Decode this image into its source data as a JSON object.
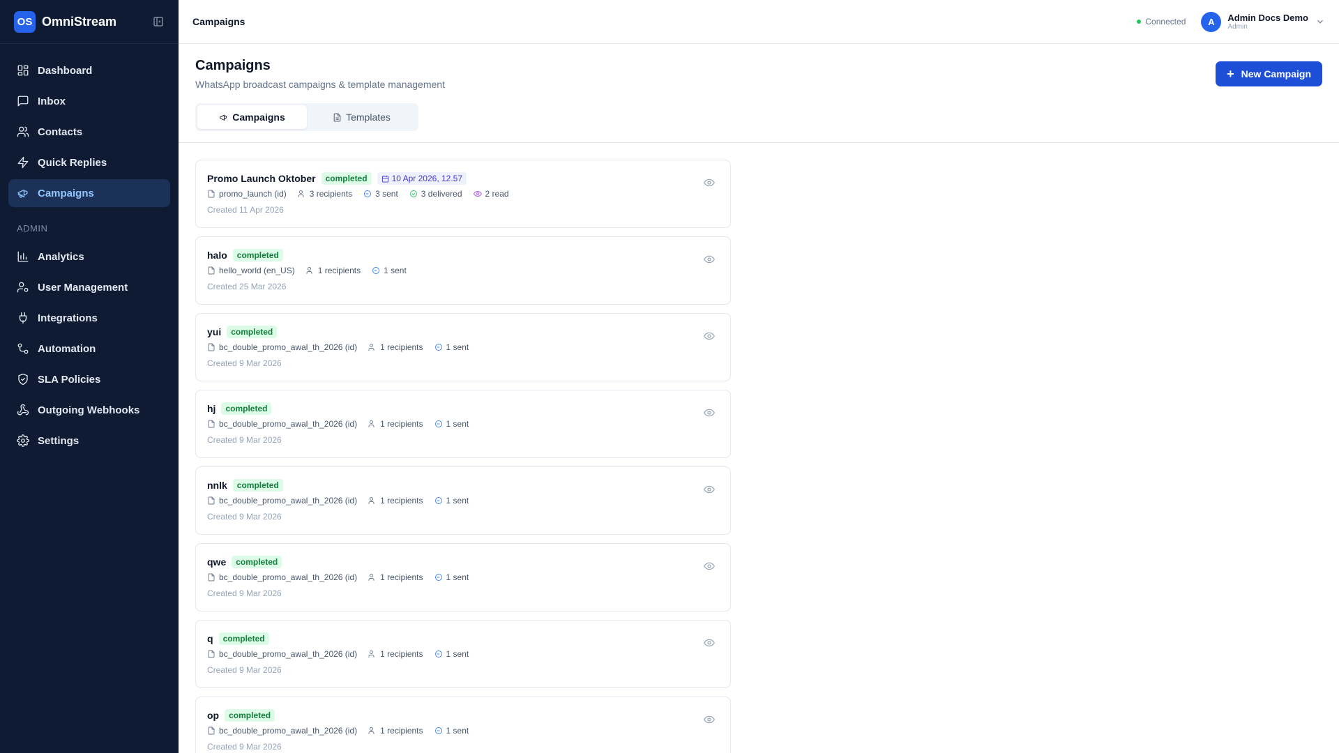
{
  "sidebar": {
    "logo_text": "OS",
    "brand": "OmniStream",
    "items": [
      {
        "label": "Dashboard",
        "icon": "dashboard-icon"
      },
      {
        "label": "Inbox",
        "icon": "inbox-icon"
      },
      {
        "label": "Contacts",
        "icon": "contacts-icon"
      },
      {
        "label": "Quick Replies",
        "icon": "lightning-icon"
      },
      {
        "label": "Campaigns",
        "icon": "megaphone-icon",
        "active": true
      }
    ],
    "admin_section": "ADMIN",
    "admin_items": [
      {
        "label": "Analytics",
        "icon": "chart-icon"
      },
      {
        "label": "User Management",
        "icon": "user-cog-icon"
      },
      {
        "label": "Integrations",
        "icon": "plug-icon"
      },
      {
        "label": "Automation",
        "icon": "workflow-icon"
      },
      {
        "label": "SLA Policies",
        "icon": "shield-icon"
      },
      {
        "label": "Outgoing Webhooks",
        "icon": "webhook-icon"
      },
      {
        "label": "Settings",
        "icon": "gear-icon"
      }
    ]
  },
  "header": {
    "title": "Campaigns",
    "status": "Connected",
    "user_initial": "A",
    "user_name": "Admin Docs Demo",
    "user_role": "Admin"
  },
  "page": {
    "title": "Campaigns",
    "subtitle": "WhatsApp broadcast campaigns & template management",
    "new_button": "New Campaign",
    "tabs": [
      {
        "label": "Campaigns",
        "active": true
      },
      {
        "label": "Templates",
        "active": false
      }
    ]
  },
  "campaigns": [
    {
      "name": "Promo Launch Oktober",
      "status": "completed",
      "scheduled": "10 Apr 2026, 12.57",
      "template": "promo_launch (id)",
      "recipients": "3 recipients",
      "sent": "3 sent",
      "delivered": "3 delivered",
      "read": "2 read",
      "created": "Created 11 Apr 2026"
    },
    {
      "name": "halo",
      "status": "completed",
      "template": "hello_world (en_US)",
      "recipients": "1 recipients",
      "sent": "1 sent",
      "created": "Created 25 Mar 2026"
    },
    {
      "name": "yui",
      "status": "completed",
      "template": "bc_double_promo_awal_th_2026 (id)",
      "recipients": "1 recipients",
      "sent": "1 sent",
      "created": "Created 9 Mar 2026"
    },
    {
      "name": "hj",
      "status": "completed",
      "template": "bc_double_promo_awal_th_2026 (id)",
      "recipients": "1 recipients",
      "sent": "1 sent",
      "created": "Created 9 Mar 2026"
    },
    {
      "name": "nnlk",
      "status": "completed",
      "template": "bc_double_promo_awal_th_2026 (id)",
      "recipients": "1 recipients",
      "sent": "1 sent",
      "created": "Created 9 Mar 2026"
    },
    {
      "name": "qwe",
      "status": "completed",
      "template": "bc_double_promo_awal_th_2026 (id)",
      "recipients": "1 recipients",
      "sent": "1 sent",
      "created": "Created 9 Mar 2026"
    },
    {
      "name": "q",
      "status": "completed",
      "template": "bc_double_promo_awal_th_2026 (id)",
      "recipients": "1 recipients",
      "sent": "1 sent",
      "created": "Created 9 Mar 2026"
    },
    {
      "name": "op",
      "status": "completed",
      "template": "bc_double_promo_awal_th_2026 (id)",
      "recipients": "1 recipients",
      "sent": "1 sent",
      "created": "Created 9 Mar 2026"
    }
  ],
  "colors": {
    "sidebar_bg": "#0f1b33",
    "accent": "#1d4ed8",
    "status_completed": "#15803d",
    "connected": "#22c55e"
  }
}
